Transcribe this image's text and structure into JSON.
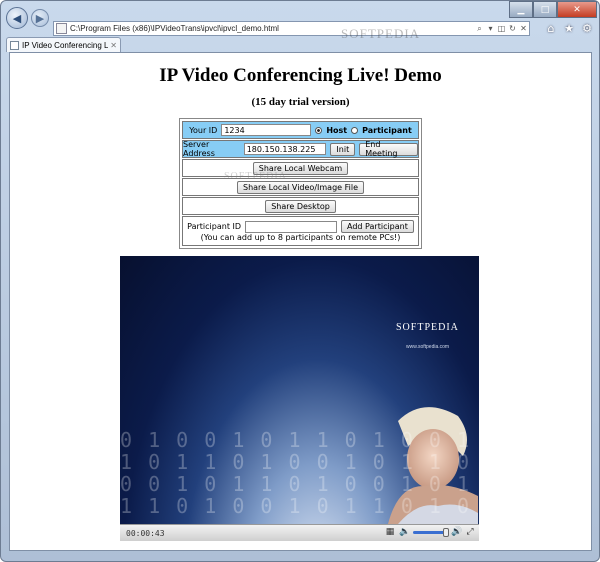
{
  "browser": {
    "address": "C:\\Program Files (x86)\\IPVideoTrans\\ipvcl\\ipvcl_demo.html",
    "tab_label": "IP Video Conferencing Live ...",
    "watermark": "SOFTPEDIA"
  },
  "page": {
    "title": "IP Video Conferencing Live! Demo",
    "subtitle": "(15 day trial version)"
  },
  "form": {
    "your_id_label": "Your ID",
    "your_id_value": "1234",
    "role_host": "Host",
    "role_participant": "Participant",
    "role_selected": "Host",
    "server_label": "Server Address",
    "server_value": "180.150.138.225",
    "init_button": "Init",
    "end_meeting_button": "End Meeting",
    "share_webcam_button": "Share Local Webcam",
    "share_file_button": "Share Local Video/Image File",
    "share_desktop_button": "Share Desktop",
    "participant_id_label": "Participant ID",
    "participant_id_value": "",
    "add_participant_button": "Add Participant",
    "note": "(You can add up to 8 participants on remote PCs!)"
  },
  "player": {
    "time": "00:00:43",
    "logo": "SOFTPEDIA",
    "url": "www.softpedia.com",
    "volume_level": 1.0
  },
  "colors": {
    "highlight_row": "#87cdf5",
    "video_bg": "#0a1438"
  }
}
